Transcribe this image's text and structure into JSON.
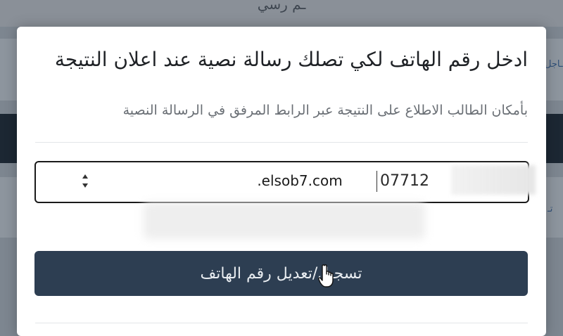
{
  "background": {
    "top_text": "ـم رسي",
    "right_fragment_1": "ـاجل",
    "right_fragment_2": "تـ"
  },
  "modal": {
    "title": "ادخل رقم الهاتف لكي تصلك رسالة نصية عند اعلان النتيجة",
    "subtitle": "بأمكان الطالب الاطلاع على النتيجة عبر الرابط المرفق في الرسالة النصية",
    "phone_input": {
      "value": "07712",
      "watermark": ".elsob7.com"
    },
    "submit_label": "تسجيل/تعديل رقم الهاتف"
  },
  "icons": {
    "cursor": "hand-pointer-icon",
    "spinner": "number-spinner-icon"
  }
}
